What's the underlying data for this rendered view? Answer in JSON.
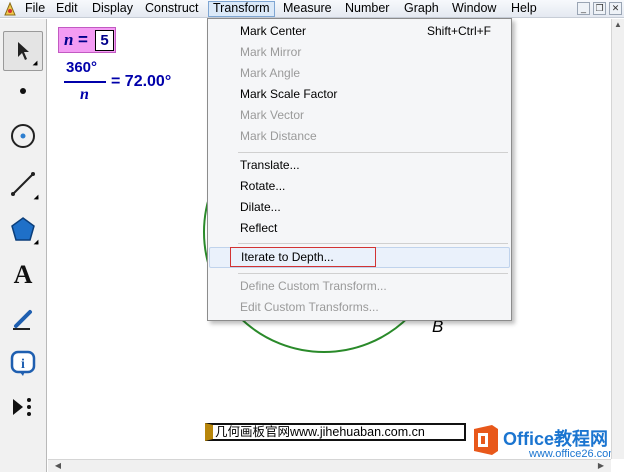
{
  "menubar": {
    "items": [
      "File",
      "Edit",
      "Display",
      "Construct",
      "Transform",
      "Measure",
      "Number",
      "Graph",
      "Window",
      "Help"
    ],
    "active": "Transform"
  },
  "toolbar": {
    "tools": [
      "arrow-tool",
      "point-tool",
      "compass-tool",
      "line-tool",
      "polygon-tool",
      "text-tool",
      "marker-tool",
      "information-tool",
      "custom-tool"
    ]
  },
  "canvas": {
    "parameter": {
      "name": "n",
      "equals": "=",
      "value": "5"
    },
    "calculation": {
      "numerator": "360°",
      "denominator": "n",
      "result": "= 72.00°"
    },
    "point_label": "B"
  },
  "transform_menu": {
    "group1": [
      {
        "label": "Mark Center",
        "shortcut": "Shift+Ctrl+F",
        "enabled": true
      },
      {
        "label": "Mark Mirror",
        "shortcut": "",
        "enabled": false
      },
      {
        "label": "Mark Angle",
        "shortcut": "",
        "enabled": false
      },
      {
        "label": "Mark Scale Factor",
        "shortcut": "",
        "enabled": true
      },
      {
        "label": "Mark Vector",
        "shortcut": "",
        "enabled": false
      },
      {
        "label": "Mark Distance",
        "shortcut": "",
        "enabled": false
      }
    ],
    "group2": [
      {
        "label": "Translate...",
        "enabled": true
      },
      {
        "label": "Rotate...",
        "enabled": true
      },
      {
        "label": "Dilate...",
        "enabled": true
      },
      {
        "label": "Reflect",
        "enabled": true
      }
    ],
    "group3": [
      {
        "label": "Iterate to Depth...",
        "enabled": true,
        "highlighted": true
      }
    ],
    "group4": [
      {
        "label": "Define Custom Transform...",
        "enabled": false
      },
      {
        "label": "Edit Custom Transforms...",
        "enabled": false
      }
    ]
  },
  "watermark": {
    "site_text": "几何画板官网www.jihehuaban.com.cn",
    "brand": "Office教程网",
    "brand_url": "www.office26.com"
  },
  "colors": {
    "circle": "#2a8a2a",
    "parameter_bg": "#f39cf3",
    "formula_text": "#0000aa",
    "focus_outline": "#d23333",
    "brand_blue": "#1b75d0",
    "office_orange": "#e8581a"
  }
}
